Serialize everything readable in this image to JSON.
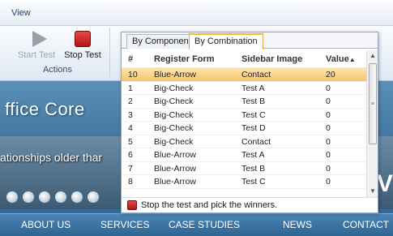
{
  "ribbon": {
    "tab_label": "View",
    "start_test_label": "Start Test",
    "stop_test_label": "Stop Test",
    "group_label": "Actions"
  },
  "site": {
    "title": "ffice Core",
    "tagline": "ationships older thar",
    "right_text": "V",
    "nav": [
      "ABOUT US",
      "SERVICES",
      "CASE STUDIES",
      "NEWS",
      "CONTACT"
    ]
  },
  "panel": {
    "tabs": [
      "By Component",
      "By Combination"
    ],
    "active_tab": "By Combination",
    "columns": [
      "#",
      "Register Form",
      "Sidebar Image",
      "Value"
    ],
    "sort_indicator": "▲",
    "rows": [
      [
        "10",
        "Blue-Arrow",
        "Contact",
        "20"
      ],
      [
        "1",
        "Big-Check",
        "Test A",
        "0"
      ],
      [
        "2",
        "Big-Check",
        "Test B",
        "0"
      ],
      [
        "3",
        "Big-Check",
        "Test C",
        "0"
      ],
      [
        "4",
        "Big-Check",
        "Test D",
        "0"
      ],
      [
        "5",
        "Big-Check",
        "Contact",
        "0"
      ],
      [
        "6",
        "Blue-Arrow",
        "Test A",
        "0"
      ],
      [
        "7",
        "Blue-Arrow",
        "Test B",
        "0"
      ],
      [
        "8",
        "Blue-Arrow",
        "Test C",
        "0"
      ]
    ],
    "status_text": "Stop the test and pick the winners."
  },
  "colors": {
    "accent": "#f0b93b",
    "selected_row": "#f7c467",
    "stop_red": "#c01c1c",
    "nav_blue": "#2d6593"
  }
}
